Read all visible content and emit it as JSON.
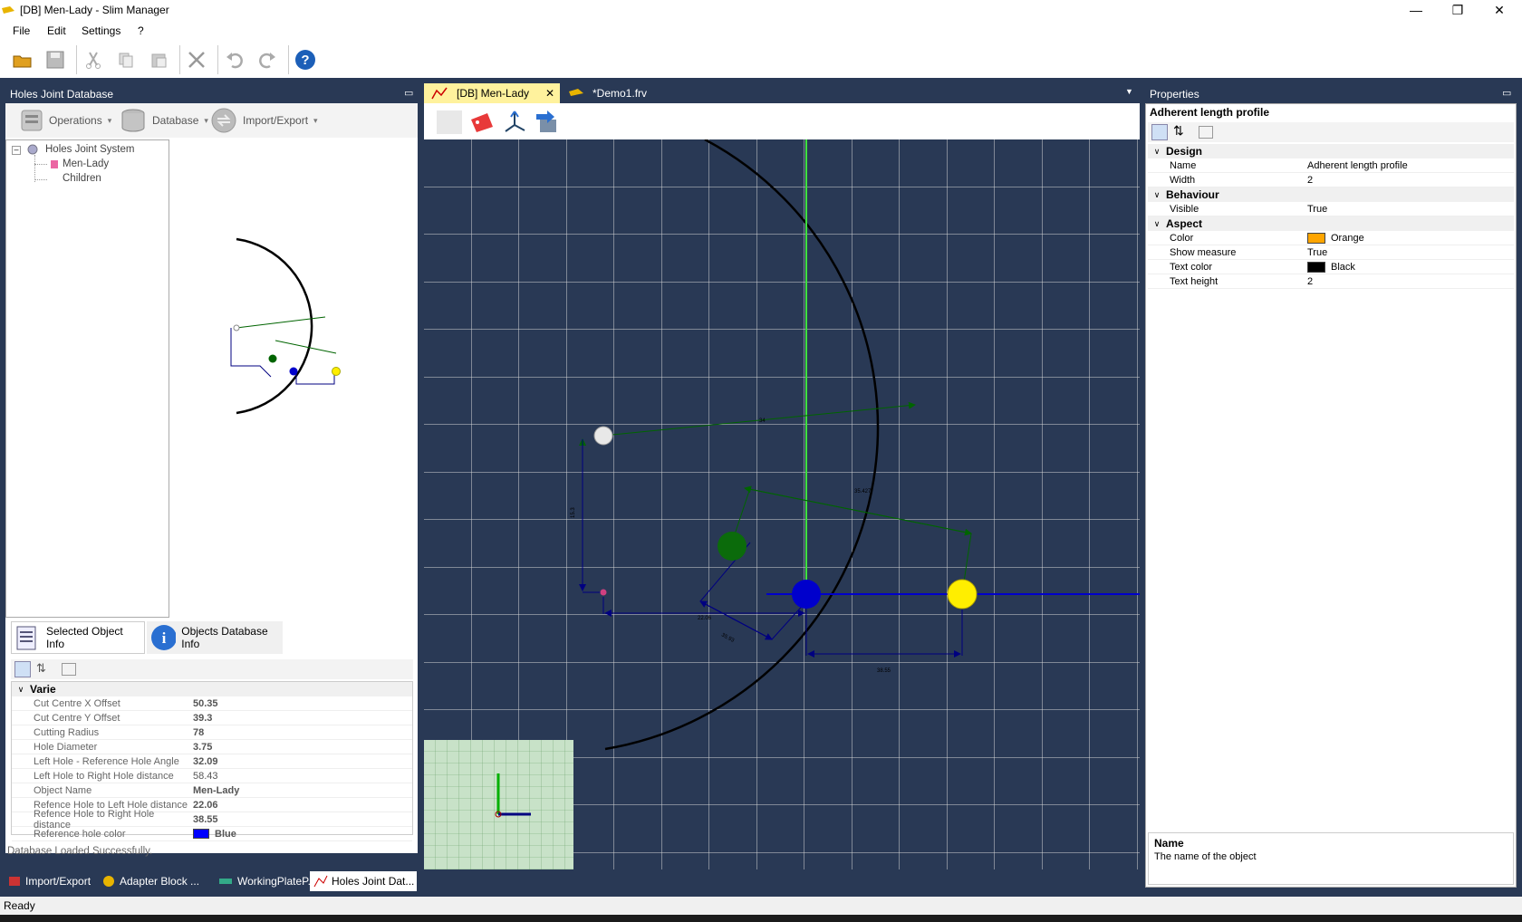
{
  "window": {
    "title": "[DB] Men-Lady - Slim Manager"
  },
  "menu": [
    "File",
    "Edit",
    "Settings",
    "?"
  ],
  "toolbar": {
    "icons": [
      "open-folder-icon",
      "save-icon",
      "cut-icon",
      "copy-icon",
      "paste-icon",
      "delete-icon",
      "undo-icon",
      "redo-icon",
      "help-icon"
    ]
  },
  "left_panel": {
    "title": "Holes Joint Database",
    "toolbar": {
      "operations": "Operations",
      "database": "Database",
      "import_export": "Import/Export"
    },
    "tree": {
      "root": "Holes Joint System",
      "items": [
        "Men-Lady",
        "Children"
      ]
    },
    "tabs": {
      "selected": "Selected Object Info",
      "objects": "Objects Database Info"
    },
    "props": {
      "category": "Varie",
      "rows": [
        {
          "name": "Cut Centre X Offset",
          "value": "50.35",
          "bold": true
        },
        {
          "name": "Cut Centre Y Offset",
          "value": "39.3",
          "bold": true
        },
        {
          "name": "Cutting Radius",
          "value": "78",
          "bold": true
        },
        {
          "name": "Hole Diameter",
          "value": "3.75",
          "bold": true
        },
        {
          "name": "Left Hole - Reference Hole Angle",
          "value": "32.09",
          "bold": true
        },
        {
          "name": "Left Hole to Right Hole distance",
          "value": "58.43",
          "bold": false
        },
        {
          "name": "Object Name",
          "value": "Men-Lady",
          "bold": true
        },
        {
          "name": "Refence Hole to Left Hole distance",
          "value": "22.06",
          "bold": true
        },
        {
          "name": "Refence Hole to Right Hole distance",
          "value": "38.55",
          "bold": true
        },
        {
          "name": "Reference hole color",
          "value": "Blue",
          "bold": true,
          "swatch": "#0000ff"
        }
      ]
    },
    "status": "Database Loaded Successfully."
  },
  "doc_tabs": [
    {
      "label": "[DB] Men-Lady",
      "active": true
    },
    {
      "label": "*Demo1.frv",
      "active": false
    }
  ],
  "canvas": {
    "labels": {
      "top": "34",
      "vertical": "15.3",
      "diag": "35.427",
      "h1": "22.06",
      "h2": "35.93",
      "h3": "38.55"
    }
  },
  "properties": {
    "title": "Properties",
    "object": "Adherent length profile",
    "groups": [
      {
        "name": "Design",
        "rows": [
          {
            "name": "Name",
            "value": "Adherent length profile"
          },
          {
            "name": "Width",
            "value": "2"
          }
        ]
      },
      {
        "name": "Behaviour",
        "rows": [
          {
            "name": "Visible",
            "value": "True"
          }
        ]
      },
      {
        "name": "Aspect",
        "rows": [
          {
            "name": "Color",
            "value": "Orange",
            "swatch": "#ffa500"
          },
          {
            "name": "Show measure",
            "value": "True"
          },
          {
            "name": "Text color",
            "value": "Black",
            "swatch": "#000000"
          },
          {
            "name": "Text height",
            "value": "2"
          }
        ]
      }
    ],
    "help_title": "Name",
    "help_text": "The name of the object"
  },
  "bottom_tabs": [
    "Import/Export",
    "Adapter Block ...",
    "WorkingPlateP...",
    "Holes Joint Dat..."
  ],
  "status_bar": "Ready",
  "colors": {
    "frame": "#293955",
    "accent_tab": "#fff29d"
  }
}
